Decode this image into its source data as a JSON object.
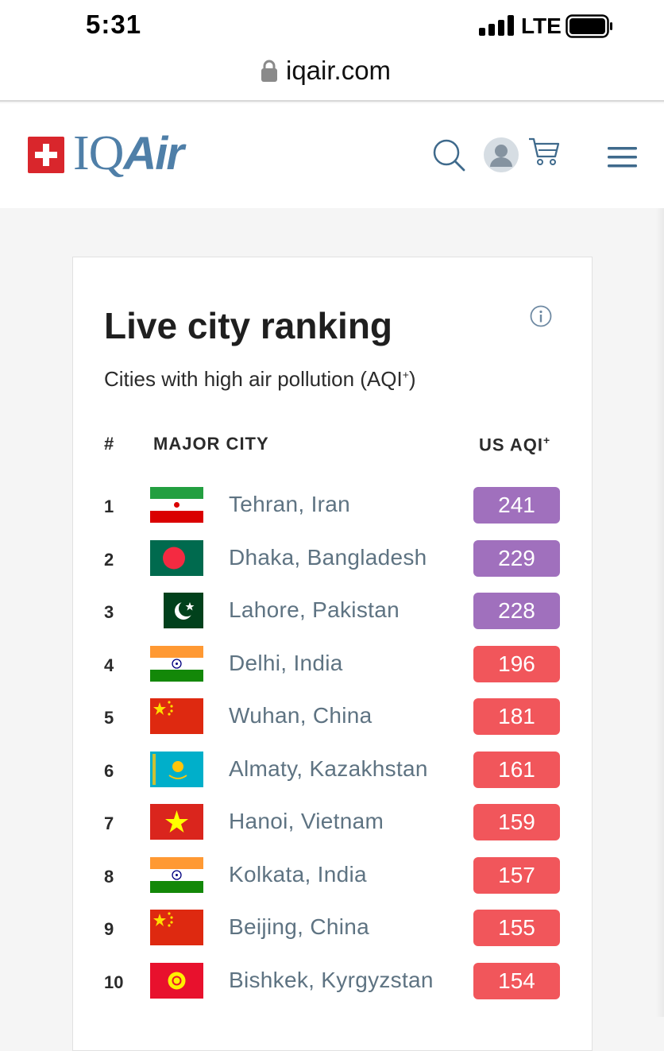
{
  "status_bar": {
    "time": "5:31",
    "network": "LTE"
  },
  "browser": {
    "url": "iqair.com"
  },
  "site": {
    "logo_iq": "IQ",
    "logo_air": "Air"
  },
  "ranking": {
    "title": "Live city ranking",
    "subtitle_prefix": "Cities with high air pollution (AQI",
    "subtitle_sup": "+",
    "subtitle_suffix": ")",
    "col_rank": "#",
    "col_city": "MAJOR CITY",
    "col_aqi": "US AQI",
    "col_aqi_sup": "+",
    "rows": [
      {
        "rank": "1",
        "city": "Tehran, Iran",
        "aqi": "241",
        "color": "#a070bd",
        "flag": "iran"
      },
      {
        "rank": "2",
        "city": "Dhaka, Bangladesh",
        "aqi": "229",
        "color": "#a070bd",
        "flag": "bangladesh"
      },
      {
        "rank": "3",
        "city": "Lahore, Pakistan",
        "aqi": "228",
        "color": "#a070bd",
        "flag": "pakistan"
      },
      {
        "rank": "4",
        "city": "Delhi, India",
        "aqi": "196",
        "color": "#f1565b",
        "flag": "india"
      },
      {
        "rank": "5",
        "city": "Wuhan, China",
        "aqi": "181",
        "color": "#f1565b",
        "flag": "china"
      },
      {
        "rank": "6",
        "city": "Almaty, Kazakhstan",
        "aqi": "161",
        "color": "#f1565b",
        "flag": "kazakhstan"
      },
      {
        "rank": "7",
        "city": "Hanoi, Vietnam",
        "aqi": "159",
        "color": "#f1565b",
        "flag": "vietnam"
      },
      {
        "rank": "8",
        "city": "Kolkata, India",
        "aqi": "157",
        "color": "#f1565b",
        "flag": "india"
      },
      {
        "rank": "9",
        "city": "Beijing, China",
        "aqi": "155",
        "color": "#f1565b",
        "flag": "china"
      },
      {
        "rank": "10",
        "city": "Bishkek, Kyrgyzstan",
        "aqi": "154",
        "color": "#f1565b",
        "flag": "kyrgyzstan"
      }
    ]
  },
  "icons": {
    "header": [
      "search-icon",
      "user-avatar-icon",
      "cart-icon",
      "menu-icon"
    ],
    "browser": [
      "lock-icon"
    ],
    "card": [
      "info-icon"
    ]
  }
}
